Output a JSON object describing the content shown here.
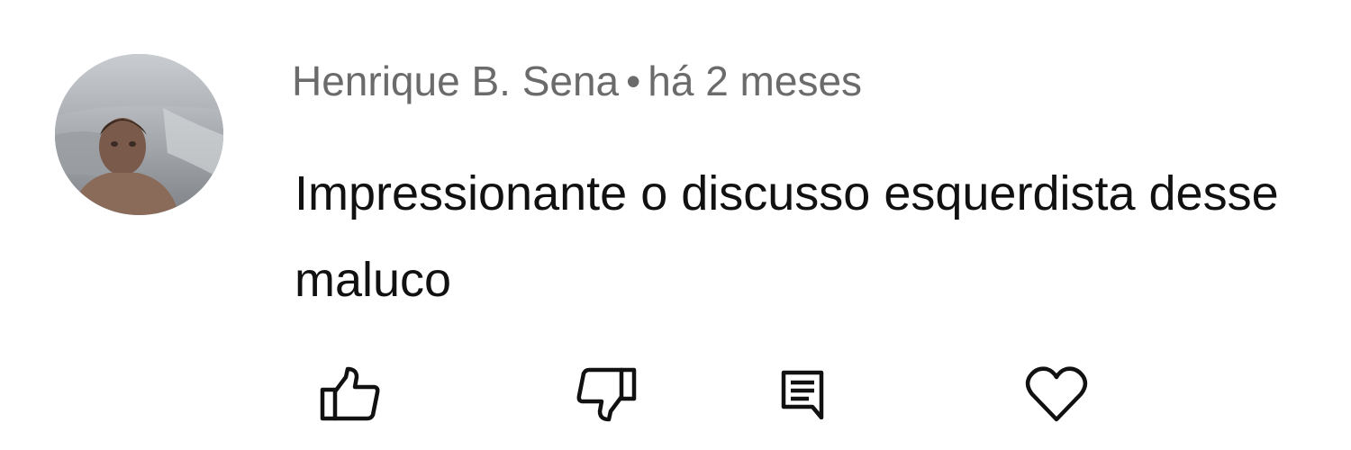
{
  "comment": {
    "author": "Henrique B. Sena",
    "separator": "•",
    "time_ago": "há 2 meses",
    "text": "Impressionante o discusso esquerdista desse maluco"
  },
  "actions": {
    "like_icon": "thumbs-up-icon",
    "dislike_icon": "thumbs-down-icon",
    "reply_icon": "reply-comment-icon",
    "heart_icon": "heart-icon"
  },
  "colors": {
    "meta_text": "#6b6b6b",
    "body_text": "#111111",
    "icon_stroke": "#111111"
  }
}
